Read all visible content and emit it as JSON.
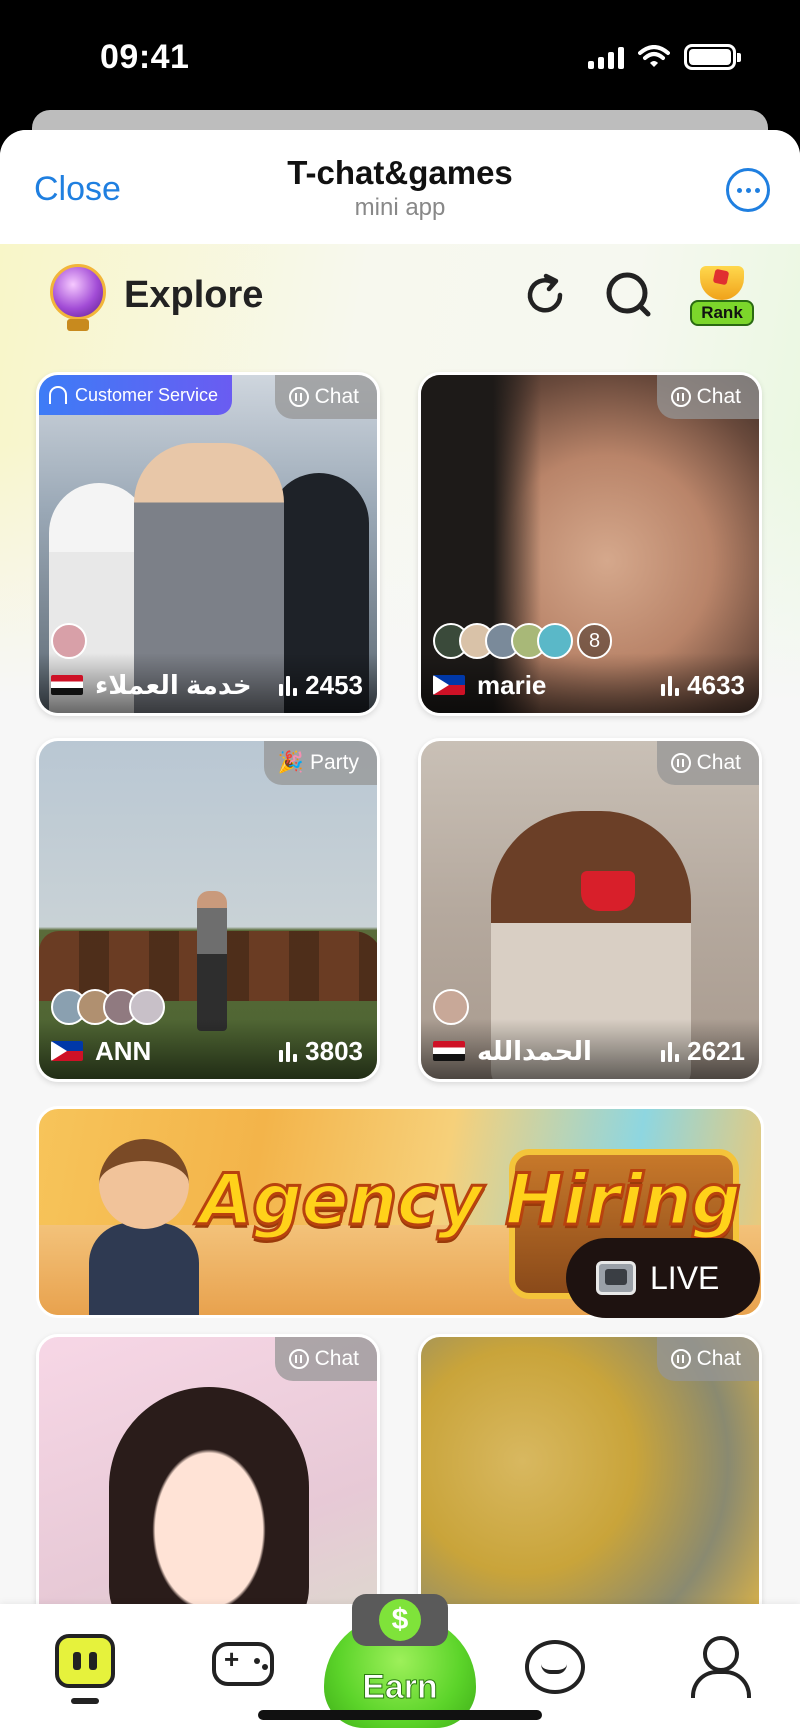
{
  "status_bar": {
    "time": "09:41"
  },
  "mini_app": {
    "close_label": "Close",
    "title": "T-chat&games",
    "subtitle": "mini app"
  },
  "explore": {
    "title": "Explore",
    "rank_label": "Rank"
  },
  "cards": [
    {
      "tag": "Chat",
      "badge": "Customer Service",
      "name": "خدمة العملاء",
      "count": "2453",
      "flag": "egypt"
    },
    {
      "tag": "Chat",
      "name": "marie",
      "count": "4633",
      "flag": "philippines",
      "more_count": "8"
    },
    {
      "tag": "Party",
      "name": "ANN",
      "count": "3803",
      "flag": "philippines"
    },
    {
      "tag": "Chat",
      "name": "الحمدالله",
      "count": "2621",
      "flag": "egypt"
    },
    {
      "tag": "Chat"
    },
    {
      "tag": "Chat",
      "live_label": "LIVE"
    }
  ],
  "banner": {
    "text": "Agency Hiring"
  },
  "nav": {
    "earn_label": "Earn",
    "earn_symbol": "$"
  },
  "colors": {
    "accent_blue": "#1f7fe0",
    "earn_green": "#5cd42a",
    "home_yellow": "#e6f23c"
  }
}
